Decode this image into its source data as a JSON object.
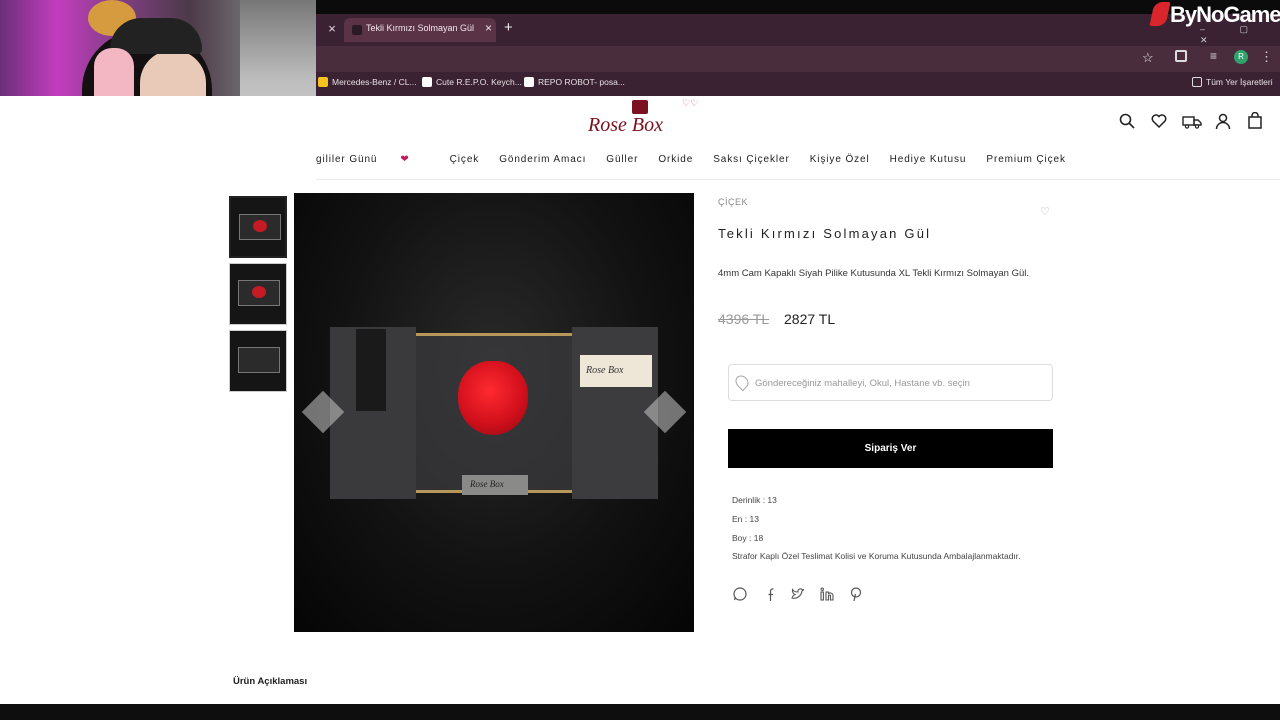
{
  "browser": {
    "tab_title": "Tekli Kırmızı Solmayan Gül",
    "tab_close": "×",
    "tab_close_left": "×",
    "new_tab": "+",
    "bookmarks": [
      "Mercedes-Benz / CL...",
      "Cute R.E.P.O. Keych...",
      "REPO ROBOT- posa..."
    ],
    "bookmark_folder": "Tüm Yer İşaretleri",
    "profile_initial": "R"
  },
  "watermark": {
    "text": "ByNoGame"
  },
  "site": {
    "logo_text": "Rose Box",
    "logo_card_text": "Rose Box",
    "nav": [
      "gililer Günü",
      "Çiçek",
      "Gönderim Amacı",
      "Güller",
      "Orkide",
      "Saksı Çiçekler",
      "Kişiye Özel",
      "Hediye Kutusu",
      "Premium Çiçek"
    ],
    "nav_heart": "❤",
    "header_icons": [
      "search-icon",
      "heart-icon",
      "truck-icon",
      "user-icon",
      "bag-icon"
    ]
  },
  "product": {
    "breadcrumb": "ÇİÇEK",
    "title": "Tekli Kırmızı Solmayan Gül",
    "description": "4mm Cam Kapaklı Siyah Pilike Kutusunda XL Tekli Kırmızı Solmayan Gül.",
    "old_price": "4396 TL",
    "new_price": "2827 TL",
    "address_placeholder": "Göndereceğiniz mahalleyi, Okul, Hastane vb. seçin",
    "order_button": "Sipariş Ver",
    "specs": {
      "depth": "Derinlik : 13",
      "width": "En : 13",
      "height": "Boy : 18",
      "note": "Strafor Kaplı Özel Teslimat Kolisi ve Koruma Kutusunda Ambalajlanmaktadır."
    },
    "share_icons": [
      "whatsapp-icon",
      "facebook-icon",
      "twitter-icon",
      "linkedin-icon",
      "pinterest-icon"
    ],
    "description_tab": "Ürün Açıklaması"
  },
  "colors": {
    "brand": "#7a1020",
    "button": "#000000",
    "browser": "#3a2232"
  }
}
